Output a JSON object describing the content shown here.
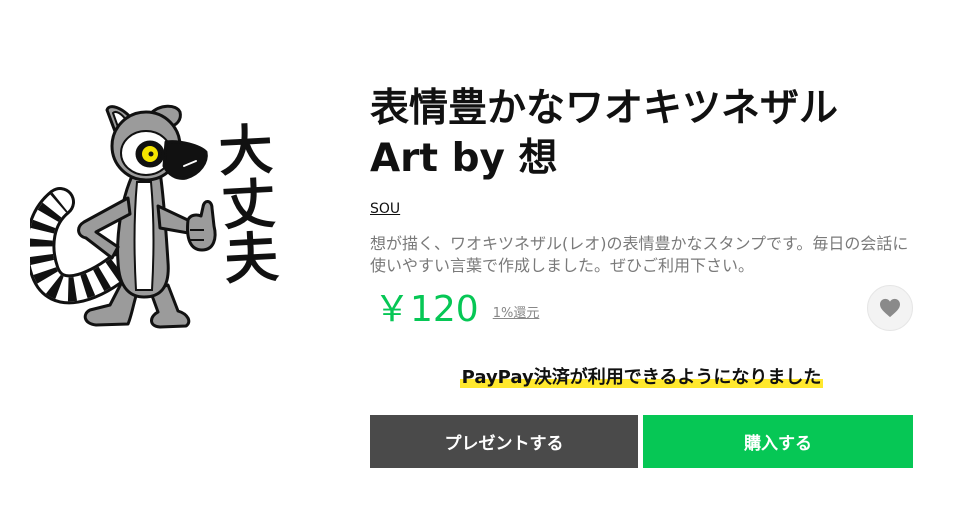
{
  "sticker": {
    "lettering": "大丈夫"
  },
  "product": {
    "title": "表情豊かなワオキツネザル Art by 想",
    "author": "SOU",
    "description": "想が描く、ワオキツネザル(レオ)の表情豊かなスタンプです。毎日の会話に使いやすい言葉で作成しました。ぜひご利用下さい。",
    "price": "￥120",
    "points": "1%還元"
  },
  "favorite": {
    "icon": "heart-icon"
  },
  "notice": {
    "text": "PayPay決済が利用できるようになりました"
  },
  "actions": {
    "gift_label": "プレゼントする",
    "buy_label": "購入する"
  },
  "colors": {
    "brand_green": "#06c755",
    "gift_gray": "#4a4a4a",
    "highlight_yellow": "#ffe82e",
    "text_gray": "#7a7a7a"
  }
}
